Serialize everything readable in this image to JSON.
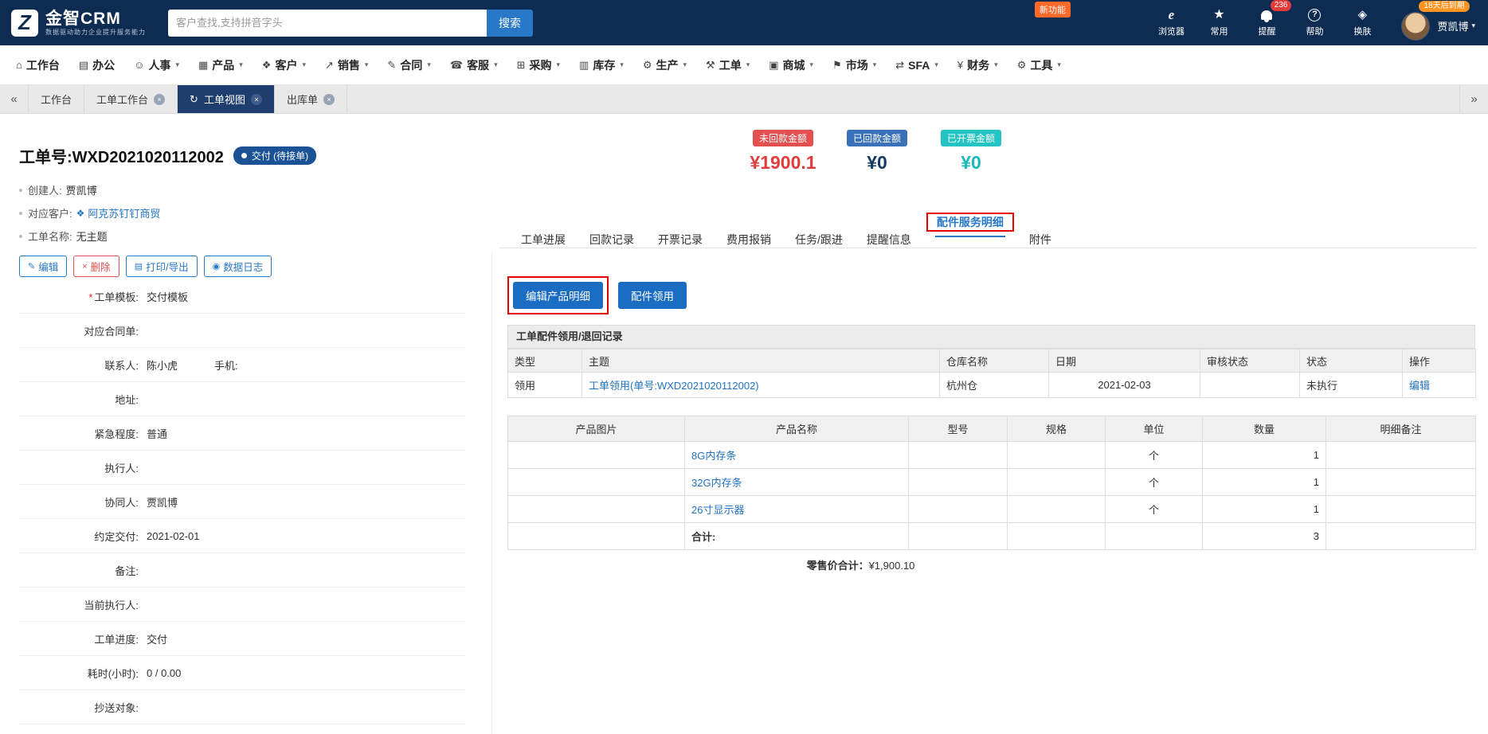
{
  "colors": {
    "topbar": "#0e2c52",
    "primary_blue": "#1a6dc3",
    "link": "#2173c2",
    "red": "#e25050",
    "teal": "#25c4c4",
    "annotation": "#e60000",
    "orange": "#ff9423"
  },
  "topbar": {
    "logo": {
      "brand": "金智CRM",
      "tagline": "数据驱动助力企业提升服务能力"
    },
    "search": {
      "placeholder": "客户查找,支持拼音字头",
      "button_label": "搜索"
    },
    "new_feature_badge": "新功能",
    "quick_icons": [
      {
        "id": "browser",
        "label": "浏览器"
      },
      {
        "id": "favorites",
        "label": "常用"
      },
      {
        "id": "reminder",
        "label": "提醒",
        "badge": "236"
      },
      {
        "id": "help",
        "label": "帮助"
      },
      {
        "id": "skin",
        "label": "换肤"
      }
    ],
    "account": {
      "expiry_badge": "18天后到期",
      "user_name": "贾凯博"
    }
  },
  "nav": {
    "items": [
      {
        "label": "工作台",
        "icon": "home",
        "dropdown": false
      },
      {
        "label": "办公",
        "icon": "office",
        "dropdown": false
      },
      {
        "label": "人事",
        "icon": "hr",
        "dropdown": true
      },
      {
        "label": "产品",
        "icon": "product",
        "dropdown": true
      },
      {
        "label": "客户",
        "icon": "customer",
        "dropdown": true
      },
      {
        "label": "销售",
        "icon": "sales",
        "dropdown": true
      },
      {
        "label": "合同",
        "icon": "contract",
        "dropdown": true
      },
      {
        "label": "客服",
        "icon": "service",
        "dropdown": true
      },
      {
        "label": "采购",
        "icon": "purchase",
        "dropdown": true
      },
      {
        "label": "库存",
        "icon": "inventory",
        "dropdown": true
      },
      {
        "label": "生产",
        "icon": "production",
        "dropdown": true
      },
      {
        "label": "工单",
        "icon": "workorder",
        "dropdown": true
      },
      {
        "label": "商城",
        "icon": "mall",
        "dropdown": true
      },
      {
        "label": "市场",
        "icon": "market",
        "dropdown": true
      },
      {
        "label": "SFA",
        "icon": "sfa",
        "dropdown": true
      },
      {
        "label": "财务",
        "icon": "finance",
        "dropdown": true
      },
      {
        "label": "工具",
        "icon": "tools",
        "dropdown": true
      }
    ]
  },
  "tabbar": {
    "tabs": [
      {
        "label": "工作台",
        "closable": false,
        "active": false
      },
      {
        "label": "工单工作台",
        "closable": true,
        "active": false
      },
      {
        "label": "工单视图",
        "closable": true,
        "active": true
      },
      {
        "label": "出库单",
        "closable": true,
        "active": false
      }
    ]
  },
  "order": {
    "number_label": "工单号:WXD2021020112002",
    "status_badge": "交付 (待接单)",
    "amounts": [
      {
        "label": "未回款金额",
        "value": "¥1900.1"
      },
      {
        "label": "已回款金额",
        "value": "¥0"
      },
      {
        "label": "已开票金额",
        "value": "¥0"
      }
    ],
    "meta": [
      {
        "label": "创建人:",
        "value": "贾凯博"
      },
      {
        "label": "对应客户:",
        "value": "阿克苏钉钉商贸"
      },
      {
        "label": "工单名称:",
        "value": "无主题"
      }
    ],
    "action_buttons": [
      {
        "label": "编辑"
      },
      {
        "label": "删除"
      },
      {
        "label": "打印/导出"
      },
      {
        "label": "数据日志"
      }
    ],
    "detail_tabs": [
      {
        "label": "工单进展",
        "active": false
      },
      {
        "label": "回款记录",
        "active": false
      },
      {
        "label": "开票记录",
        "active": false
      },
      {
        "label": "费用报销",
        "active": false
      },
      {
        "label": "任务/跟进",
        "active": false
      },
      {
        "label": "提醒信息",
        "active": false
      },
      {
        "label": "配件服务明细",
        "active": true
      },
      {
        "label": "附件",
        "active": false
      }
    ]
  },
  "form": {
    "fields": [
      {
        "label": "工单模板:",
        "value": "交付模板",
        "required": true
      },
      {
        "label": "对应合同单:",
        "value": ""
      },
      {
        "label": "联系人:",
        "value": "陈小虎",
        "extra_label": "手机:"
      },
      {
        "label": "地址:",
        "value": ""
      },
      {
        "label": "紧急程度:",
        "value": "普通"
      },
      {
        "label": "执行人:",
        "value": ""
      },
      {
        "label": "协同人:",
        "value": "贾凯博"
      },
      {
        "label": "约定交付:",
        "value": "2021-02-01"
      },
      {
        "label": "备注:",
        "value": ""
      },
      {
        "label": "当前执行人:",
        "value": ""
      },
      {
        "label": "工单进度:",
        "value": "交付"
      },
      {
        "label": "耗时(小时):",
        "value": "0 / 0.00"
      },
      {
        "label": "抄送对象:",
        "value": ""
      }
    ]
  },
  "parts": {
    "buttons": [
      {
        "label": "编辑产品明细",
        "highlighted": true
      },
      {
        "label": "配件领用",
        "highlighted": false
      }
    ],
    "record_section_title": "工单配件领用/退回记录",
    "record_table": {
      "headers": [
        "类型",
        "主题",
        "仓库名称",
        "日期",
        "审核状态",
        "状态",
        "操作"
      ],
      "rows": [
        {
          "type": "领用",
          "subject": "工单领用(单号:WXD2021020112002)",
          "warehouse": "杭州仓",
          "date": "2021-02-03",
          "audit_status": "",
          "status": "未执行",
          "action": "编辑"
        }
      ]
    },
    "product_table": {
      "headers": [
        "产品图片",
        "产品名称",
        "型号",
        "规格",
        "单位",
        "数量",
        "明细备注"
      ],
      "rows": [
        {
          "image": "",
          "name": "8G内存条",
          "model": "",
          "spec": "",
          "unit": "个",
          "qty": "1",
          "note": ""
        },
        {
          "image": "",
          "name": "32G内存条",
          "model": "",
          "spec": "",
          "unit": "个",
          "qty": "1",
          "note": ""
        },
        {
          "image": "",
          "name": "26寸显示器",
          "model": "",
          "spec": "",
          "unit": "个",
          "qty": "1",
          "note": ""
        }
      ],
      "total_label": "合计:",
      "total_qty": "3"
    },
    "retail_total": {
      "label": "零售价合计：",
      "value": "¥1,900.10"
    }
  }
}
